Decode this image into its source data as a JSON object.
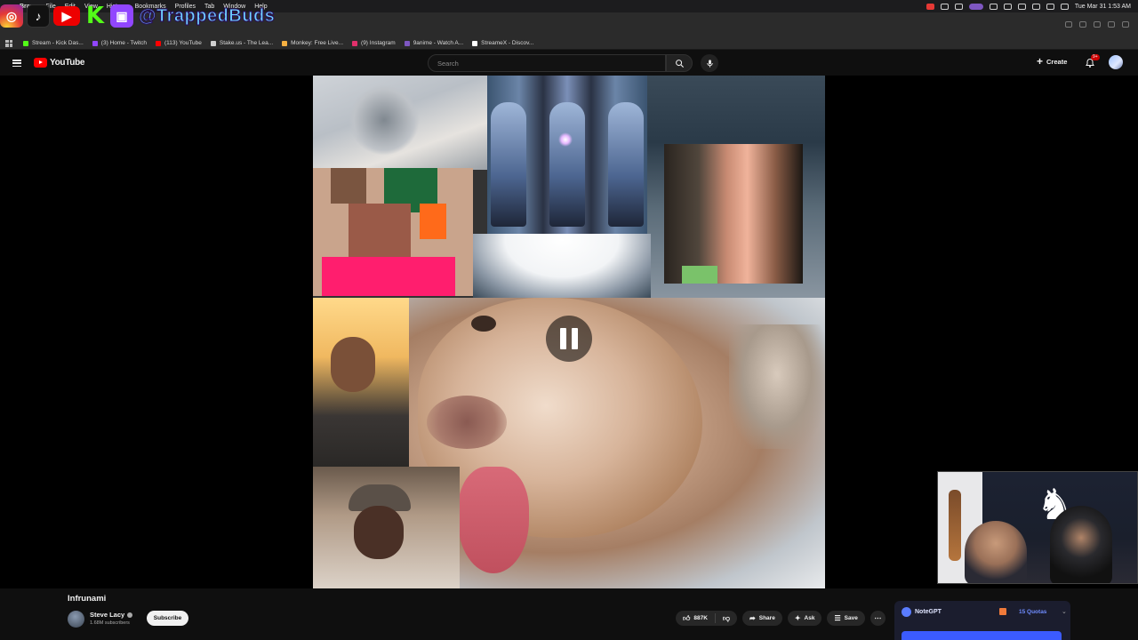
{
  "menubar": {
    "app": "Brave",
    "items": [
      "File",
      "Edit",
      "View",
      "History",
      "Bookmarks",
      "Profiles",
      "Tab",
      "Window",
      "Help"
    ],
    "clock": "Tue Mar 31  1:53 AM"
  },
  "overlay": {
    "handle": "@TrappedBuds",
    "icons": [
      "instagram-icon",
      "tiktok-icon",
      "youtube-icon",
      "kick-icon",
      "twitch-icon"
    ]
  },
  "bookmarks": [
    {
      "label": "Stream - Kick Das...",
      "color": "#53fc18"
    },
    {
      "label": "(3) Home - Twitch",
      "color": "#9146ff"
    },
    {
      "label": "(113) YouTube",
      "color": "#ff0000"
    },
    {
      "label": "Stake.us - The Lea...",
      "color": "#cfcfcf"
    },
    {
      "label": "Monkey: Free Live...",
      "color": "#f5b041"
    },
    {
      "label": "(9) Instagram",
      "color": "#e1306c"
    },
    {
      "label": "9anime - Watch A...",
      "color": "#7e57c2"
    },
    {
      "label": "StreameX - Discov...",
      "color": "#ffffff"
    }
  ],
  "youtube": {
    "logo_text": "YouTube",
    "search_placeholder": "Search",
    "create_label": "Create",
    "notification_badge": "9+"
  },
  "video": {
    "title": "Infrunami",
    "channel": "Steve Lacy",
    "subscribers": "1.68M subscribers",
    "subscribe_label": "Subscribe",
    "likes": "887K",
    "share_label": "Share",
    "ask_label": "Ask",
    "save_label": "Save",
    "state": "paused"
  },
  "notegpt": {
    "name": "NoteGPT",
    "quota": "15 Quotas"
  }
}
